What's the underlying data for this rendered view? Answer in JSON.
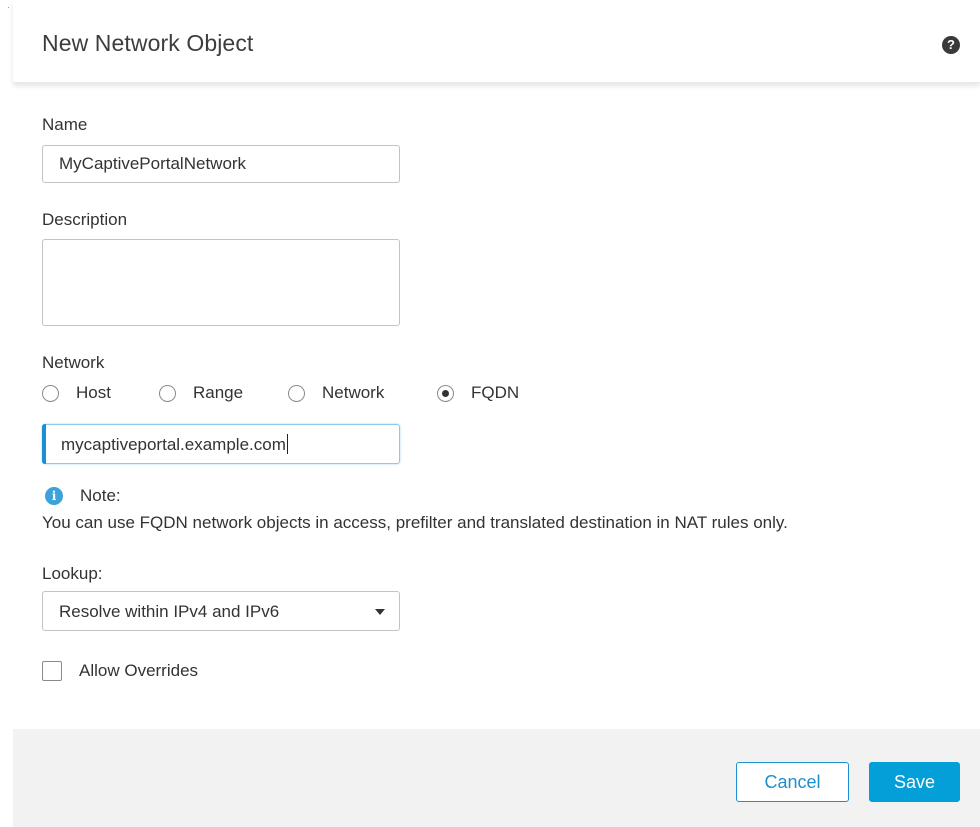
{
  "dialog": {
    "title": "New Network Object",
    "help_icon": "question-circle-icon"
  },
  "form": {
    "name": {
      "label": "Name",
      "value": "MyCaptivePortalNetwork"
    },
    "description": {
      "label": "Description",
      "value": ""
    },
    "network": {
      "label": "Network",
      "options": [
        "Host",
        "Range",
        "Network",
        "FQDN"
      ],
      "selected": "FQDN",
      "fqdn_value": "mycaptiveportal.example.com"
    },
    "note": {
      "icon": "info-icon",
      "title": "Note:",
      "text": "You can use FQDN network objects in access, prefilter and translated destination in NAT rules only."
    },
    "lookup": {
      "label": "Lookup:",
      "selected": "Resolve within IPv4 and IPv6"
    },
    "allow_overrides": {
      "label": "Allow Overrides",
      "checked": false
    }
  },
  "footer": {
    "cancel_label": "Cancel",
    "save_label": "Save"
  },
  "colors": {
    "accent": "#049fd9",
    "cancel_border": "#1c8fcf",
    "info_icon": "#3da2d9",
    "footer_bg": "#f2f2f2"
  }
}
